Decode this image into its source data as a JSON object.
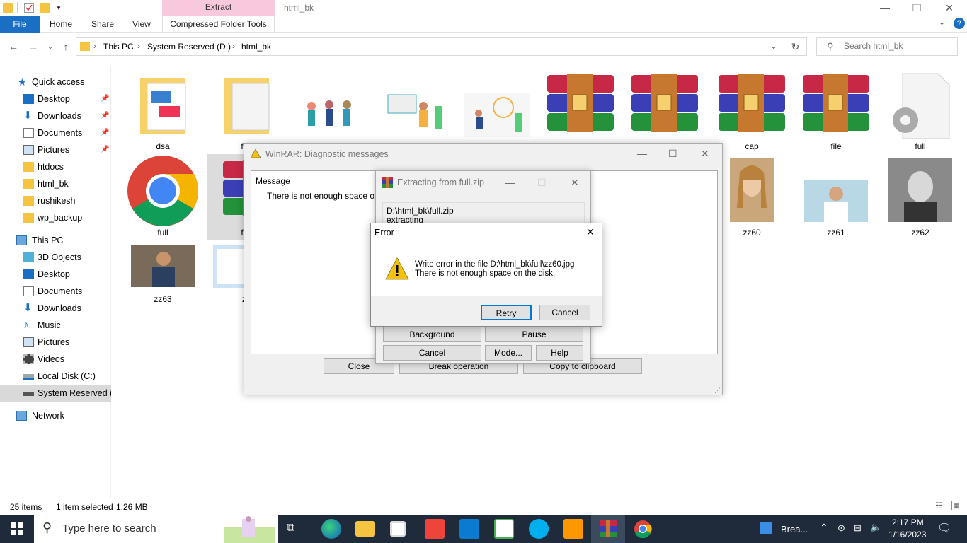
{
  "titlebar": {
    "context_tab": "Extract",
    "window_title": "html_bk"
  },
  "ribbon": {
    "file": "File",
    "home": "Home",
    "share": "Share",
    "view": "View",
    "context_tools": "Compressed Folder Tools"
  },
  "address": {
    "crumbs": [
      "This PC",
      "System Reserved (D:)",
      "html_bk"
    ]
  },
  "search": {
    "placeholder": "Search html_bk"
  },
  "nav": {
    "quick_access": "Quick access",
    "qa_items": [
      "Desktop",
      "Downloads",
      "Documents",
      "Pictures",
      "htdocs",
      "html_bk",
      "rushikesh",
      "wp_backup"
    ],
    "this_pc": "This PC",
    "pc_items": [
      "3D Objects",
      "Desktop",
      "Documents",
      "Downloads",
      "Music",
      "Pictures",
      "Videos",
      "Local Disk (C:)",
      "System Reserved (D:)"
    ],
    "network": "Network"
  },
  "files": {
    "row1": [
      "dsa",
      "full",
      "",
      "",
      "",
      "",
      "",
      "cap",
      "file",
      "full"
    ],
    "row2": [
      "full",
      "full",
      "",
      "",
      "",
      "",
      "",
      "zz60",
      "zz61",
      "zz62"
    ],
    "row3": [
      "zz63",
      "zz"
    ]
  },
  "status": {
    "count": "25 items",
    "selected": "1 item selected",
    "size": "1.26 MB"
  },
  "winrar_diag": {
    "title": "WinRAR: Diagnostic messages",
    "column": "Message",
    "message": "There is not enough space on th",
    "close": "Close",
    "break": "Break operation",
    "copy": "Copy to clipboard"
  },
  "extracting": {
    "title": "Extracting from full.zip",
    "path": "D:\\html_bk\\full.zip",
    "status": "extracting",
    "background": "Background",
    "pause": "Pause",
    "cancel": "Cancel",
    "mode": "Mode...",
    "help": "Help"
  },
  "error": {
    "title": "Error",
    "line1": "Write error in the file D:\\html_bk\\full\\zz60.jpg",
    "line2": "There is not enough space on the disk.",
    "retry": "Retry",
    "cancel": "Cancel"
  },
  "taskbar": {
    "search": "Type here to search",
    "news": "Brea...",
    "time": "2:17 PM",
    "date": "1/16/2023"
  },
  "colors": {
    "accent": "#1a6fc4",
    "taskbar": "#1f2b3a",
    "context_tab": "#f8c9dc"
  }
}
